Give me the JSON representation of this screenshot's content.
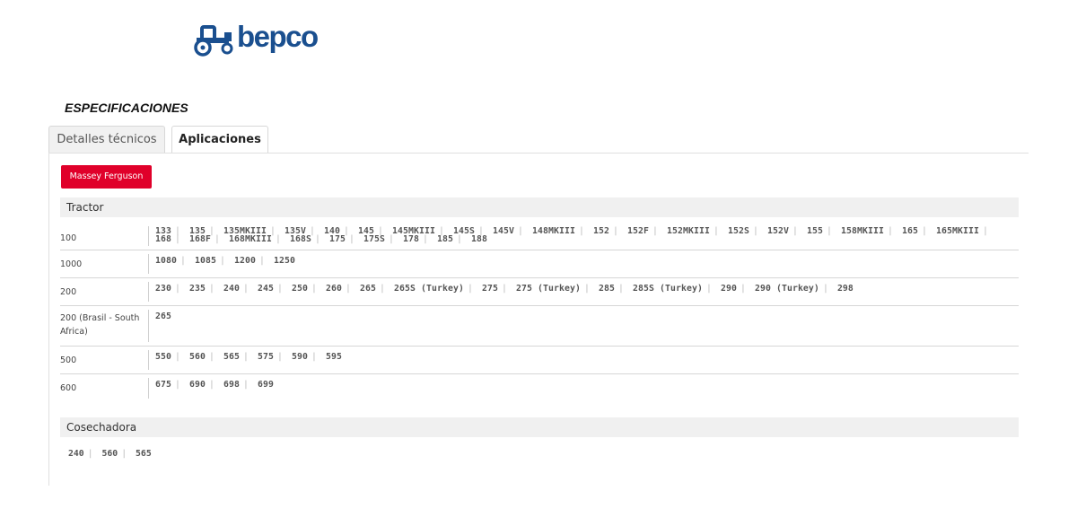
{
  "brand": {
    "logo_text": "bepco"
  },
  "header": {
    "title": "ESPECIFICACIONES"
  },
  "tabs": [
    {
      "label": "Detalles técnicos",
      "active": false
    },
    {
      "label": "Aplicaciones",
      "active": true
    }
  ],
  "manufacturer": {
    "label": "Massey Ferguson",
    "color": "#e0002a"
  },
  "sections": [
    {
      "title": "Tractor",
      "rows": [
        {
          "series": "100",
          "models": [
            "133",
            "135",
            "135MKIII",
            "135V",
            "140",
            "145",
            "145MKIII",
            "145S",
            "145V",
            "148MKIII",
            "152",
            "152F",
            "152MKIII",
            "152S",
            "152V",
            "155",
            "158MKIII",
            "165",
            "165MKIII",
            "168",
            "168F",
            "168MKIII",
            "168S",
            "175",
            "175S",
            "178",
            "185",
            "188"
          ]
        },
        {
          "series": "1000",
          "models": [
            "1080",
            "1085",
            "1200",
            "1250"
          ]
        },
        {
          "series": "200",
          "models": [
            "230",
            "235",
            "240",
            "245",
            "250",
            "260",
            "265",
            "265S (Turkey)",
            "275",
            "275 (Turkey)",
            "285",
            "285S (Turkey)",
            "290",
            "290 (Turkey)",
            "298"
          ]
        },
        {
          "series": "200 (Brasil - South Africa)",
          "models": [
            "265"
          ]
        },
        {
          "series": "500",
          "models": [
            "550",
            "560",
            "565",
            "575",
            "590",
            "595"
          ]
        },
        {
          "series": "600",
          "models": [
            "675",
            "690",
            "698",
            "699"
          ]
        }
      ]
    },
    {
      "title": "Cosechadora",
      "models": [
        "240",
        "560",
        "565"
      ]
    }
  ]
}
